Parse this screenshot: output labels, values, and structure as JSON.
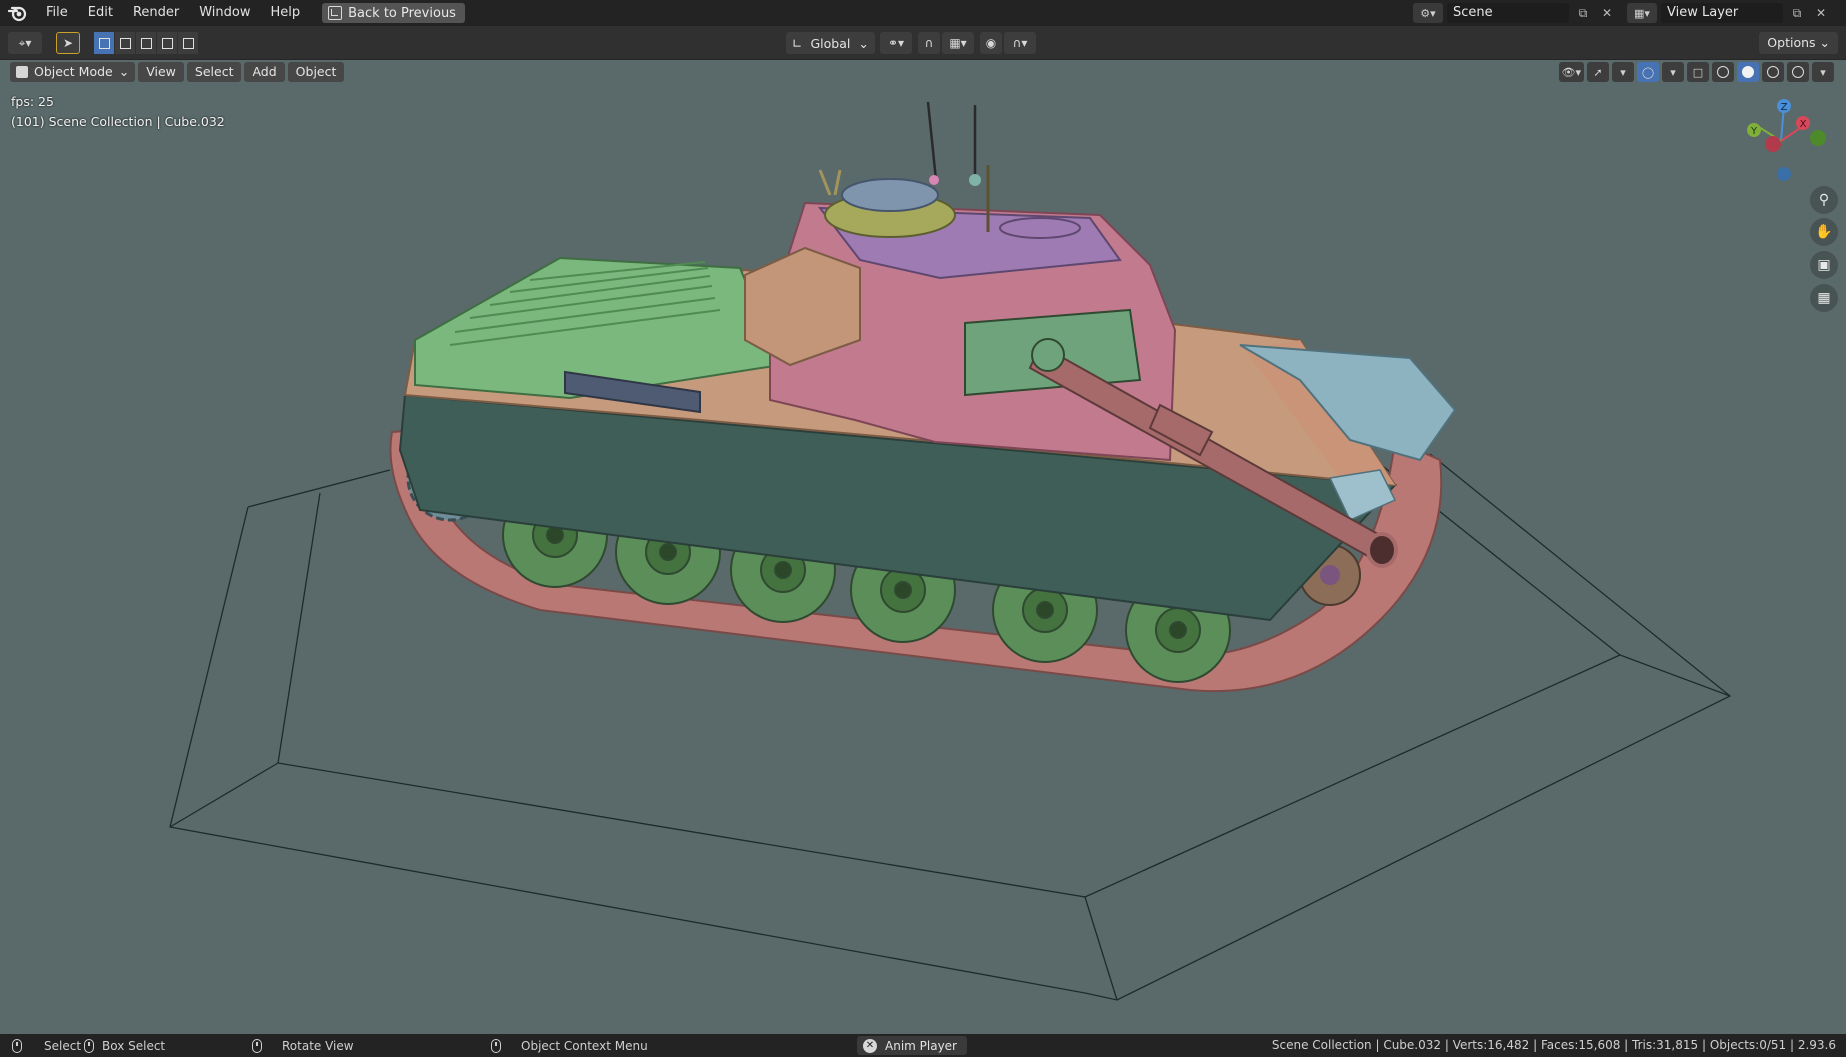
{
  "menu": {
    "items": [
      "File",
      "Edit",
      "Render",
      "Window",
      "Help"
    ],
    "back_label": "Back to Previous"
  },
  "scene": {
    "name": "Scene",
    "view_layer": "View Layer"
  },
  "toolbar": {
    "orientation": "Global",
    "options_label": "Options"
  },
  "viewport": {
    "mode": "Object Mode",
    "menus": [
      "View",
      "Select",
      "Add",
      "Object"
    ],
    "fps": "fps: 25",
    "object_info": "(101) Scene Collection | Cube.032",
    "gizmo": {
      "z": "Z",
      "y": "Y",
      "x": "X"
    }
  },
  "statusbar": {
    "select": "Select",
    "box_select": "Box Select",
    "rotate": "Rotate View",
    "context_menu": "Object Context Menu",
    "anim_player": "Anim Player",
    "stats": "Scene Collection | Cube.032 | Verts:16,482 | Faces:15,608 | Tris:31,815 | Objects:0/51 | 2.93.6"
  },
  "colors": {
    "accent": "#4772b3",
    "viewport_bg": "#5a6a6a",
    "hull": "#3f5e57",
    "turret": "#c27a8e",
    "deck": "#c69a7c",
    "engine_grille": "#7ab87d",
    "track": "#b97874",
    "wheels": "#5c8e5a",
    "armor_plate": "#8db3c1"
  }
}
